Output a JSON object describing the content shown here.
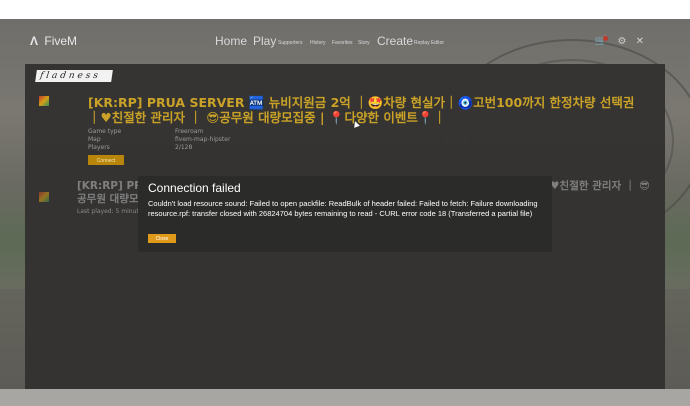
{
  "app": {
    "logo_mark": "Λ",
    "logo_text": "FiveM"
  },
  "nav": {
    "home": "Home",
    "play": "Play",
    "supporters": "Supporters",
    "history": "History",
    "favorites": "Favorites",
    "story": "Story",
    "create": "Create",
    "replay_editor": "Replay Editor"
  },
  "top_icons": {
    "store": "🛒",
    "settings": "⚙",
    "close": "✕"
  },
  "filter": {
    "text": "f l a d n e s s"
  },
  "server1": {
    "name": "[KR:RP] PRUA SERVER 🏧 뉴비지원금 2억 ｜🤩차량 현실가｜🧿고번100까지 한정차량 선택권 ｜♥친절한 관리자 ｜ 😎공무원 대량모집중 | 📍다양한 이벤트📍｜",
    "labels": [
      "Game type",
      "Map",
      "Players"
    ],
    "values": [
      "Freeroam",
      "fivem-map-hipster",
      "2/128"
    ],
    "connect_label": "Connect"
  },
  "server2": {
    "name": "[KR:RP] PRUA SERVER 🏧 뉴비지원금 2억 ｜🤩차량 현실가｜🧿고번100까지 한정차량 선택권 ｜♥친절한 관리자 ｜ 😎공무원 대량모집중",
    "last_played": "Last played: 5 minutes ago"
  },
  "dialog": {
    "title": "Connection failed",
    "message": "Couldn't load resource sound: Failed to open packfile: ReadBulk of header failed: Failed to fetch: Failure downloading resource.rpf: transfer closed with 26824704 bytes remaining to read - CURL error code 18 (Transferred a partial file)",
    "close_label": "Close"
  },
  "colors": {
    "accent": "#c9a227",
    "button": "#e09a1a"
  }
}
